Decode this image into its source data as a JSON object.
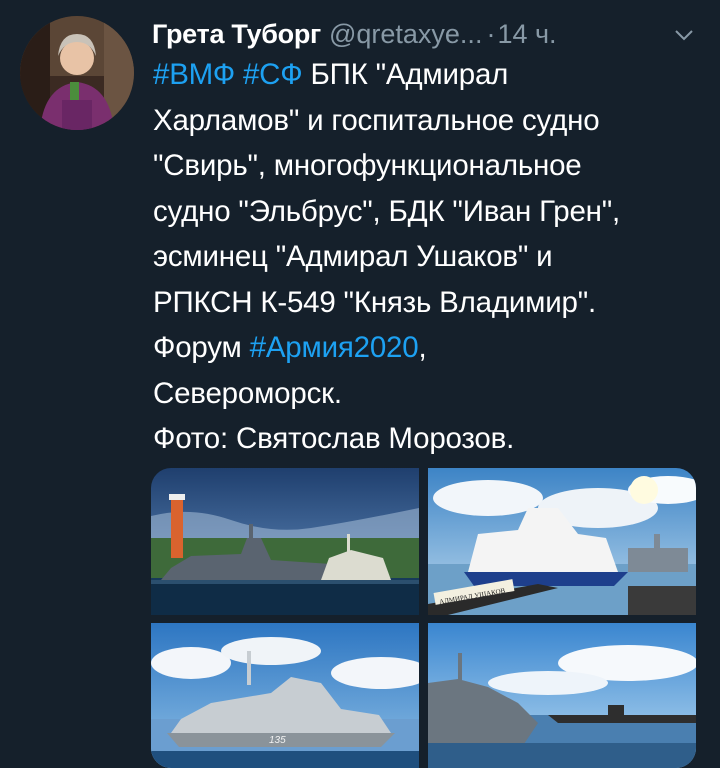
{
  "tweet": {
    "author_name": "Грета Туборг",
    "author_handle": "@qretaxye...",
    "separator": "·",
    "timestamp": "14 ч.",
    "text_lines": [
      [
        {
          "t": "#ВМФ",
          "tag": true
        },
        {
          "t": " ",
          "tag": false
        },
        {
          "t": "#СФ",
          "tag": true
        },
        {
          "t": " БПК \"Адмирал",
          "tag": false
        }
      ],
      [
        {
          "t": "Харламов\" и госпитальное судно",
          "tag": false
        }
      ],
      [
        {
          "t": "\"Свирь\", многофункциональное",
          "tag": false
        }
      ],
      [
        {
          "t": "судно \"Эльбрус\", БДК \"Иван Грен\",",
          "tag": false
        }
      ],
      [
        {
          "t": "эсминец \"Адмирал Ушаков\" и",
          "tag": false
        }
      ],
      [
        {
          "t": "РПКСН К-549 \"Князь Владимир\".",
          "tag": false
        }
      ],
      [
        {
          "t": "Форум ",
          "tag": false
        },
        {
          "t": "#Армия2020",
          "tag": true
        },
        {
          "t": ",",
          "tag": false
        }
      ],
      [
        {
          "t": "Североморск.",
          "tag": false
        }
      ],
      [
        {
          "t": "Фото: Святослав Морозов.",
          "tag": false
        }
      ]
    ]
  },
  "photos": [
    {
      "hull_number": "",
      "sign_text": ""
    },
    {
      "hull_number": "",
      "sign_text": "АДМИРАЛ УШАКОВ"
    },
    {
      "hull_number": "135",
      "sign_text": ""
    },
    {
      "hull_number": "",
      "sign_text": ""
    }
  ],
  "icons": {
    "menu": "chevron-down-icon"
  },
  "colors": {
    "background": "#15202b",
    "text": "#ffffff",
    "muted": "#8899a6",
    "link": "#1da1f2"
  }
}
